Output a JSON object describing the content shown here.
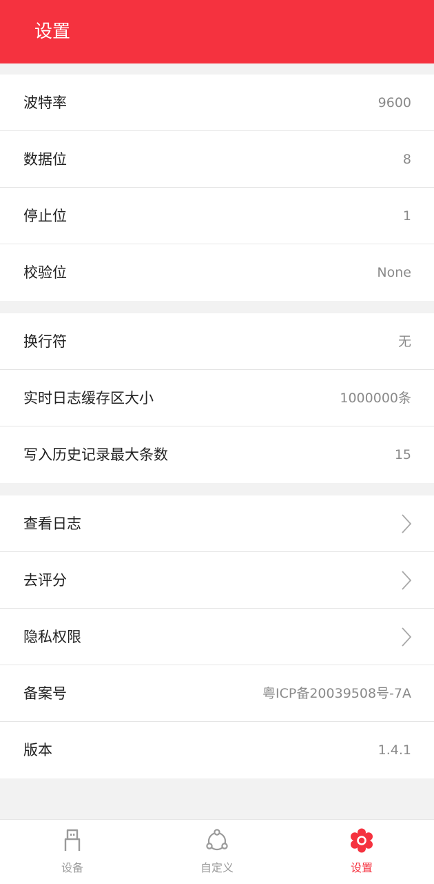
{
  "header": {
    "title": "设置"
  },
  "serial": {
    "baud_label": "波特率",
    "baud_value": "9600",
    "databits_label": "数据位",
    "databits_value": "8",
    "stopbits_label": "停止位",
    "stopbits_value": "1",
    "parity_label": "校验位",
    "parity_value": "None"
  },
  "log": {
    "newline_label": "换行符",
    "newline_value": "无",
    "buffer_label": "实时日志缓存区大小",
    "buffer_value": "1000000条",
    "history_label": "写入历史记录最大条数",
    "history_value": "15"
  },
  "misc": {
    "viewlog_label": "查看日志",
    "rate_label": "去评分",
    "privacy_label": "隐私权限",
    "icp_label": "备案号",
    "icp_value": "粤ICP备20039508号-7A",
    "version_label": "版本",
    "version_value": "1.4.1"
  },
  "tabs": {
    "device": "设备",
    "custom": "自定义",
    "settings": "设置"
  },
  "colors": {
    "accent": "#f5323f",
    "inactive": "#9a9a9a"
  }
}
